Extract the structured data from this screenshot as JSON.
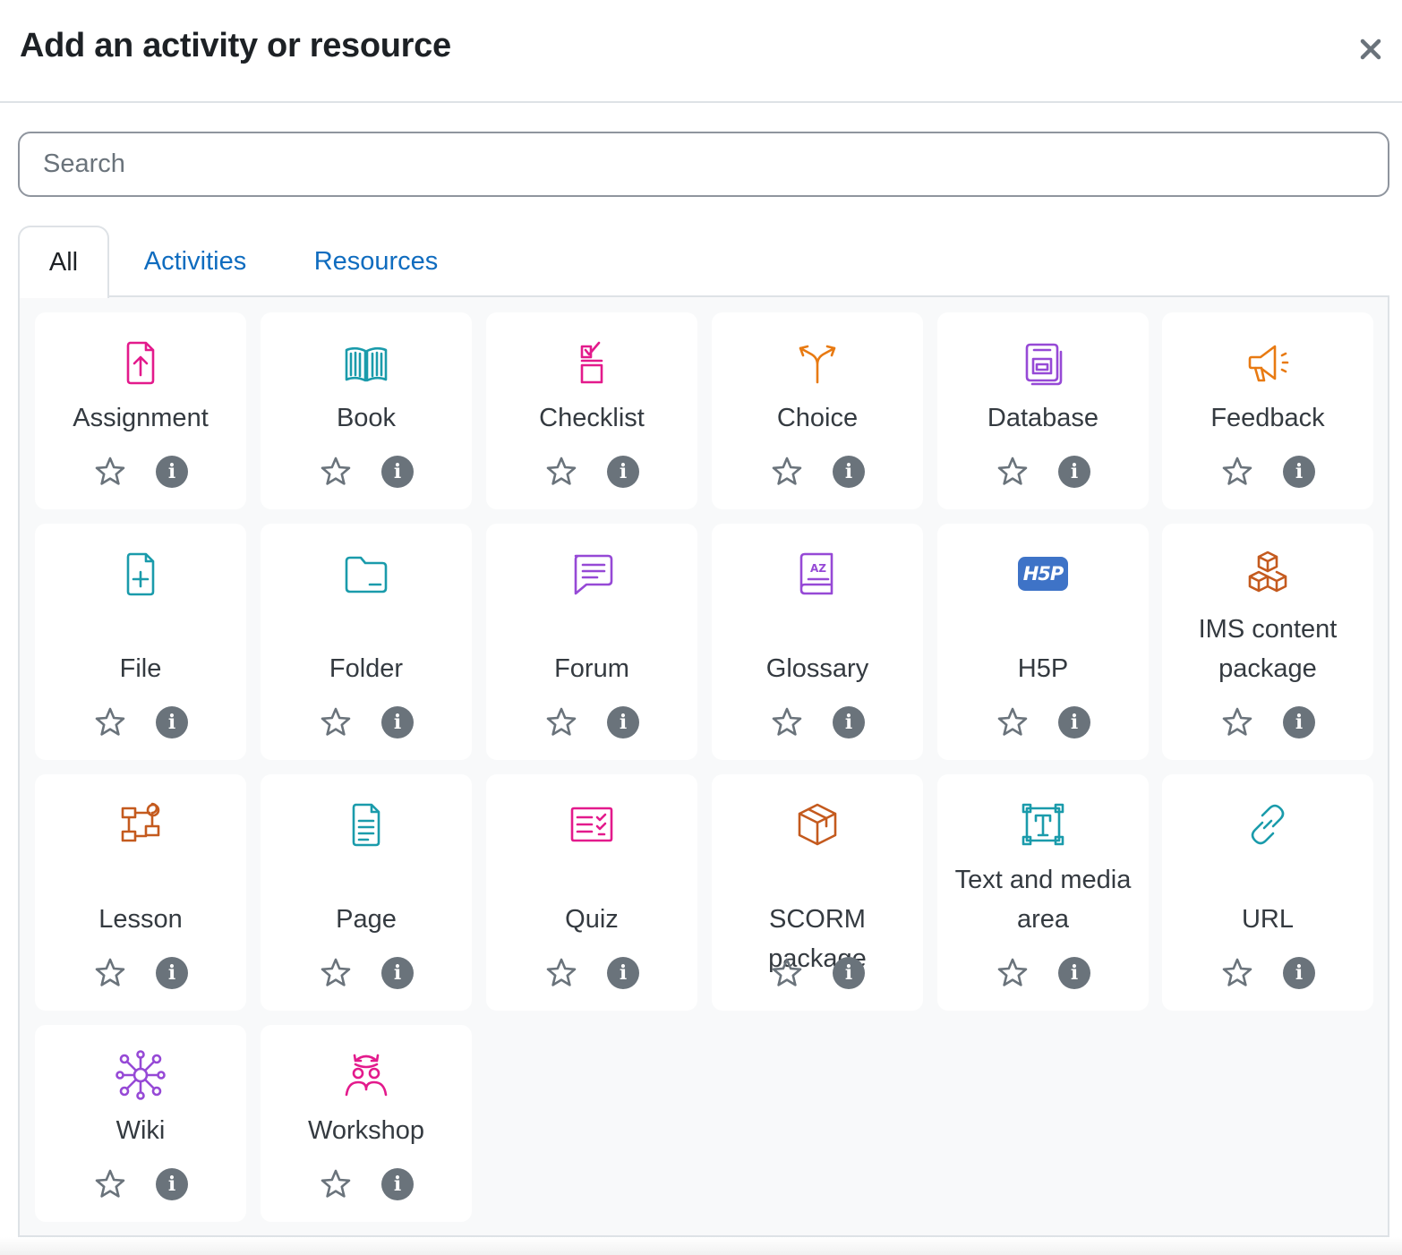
{
  "modal": {
    "title": "Add an activity or resource",
    "close_icon": "close-icon"
  },
  "search": {
    "placeholder": "Search",
    "value": ""
  },
  "tabs": [
    {
      "label": "All",
      "active": true
    },
    {
      "label": "Activities",
      "active": false
    },
    {
      "label": "Resources",
      "active": false
    }
  ],
  "items": [
    {
      "label": "Assignment",
      "icon": "assignment-icon",
      "color": "#e31a8c"
    },
    {
      "label": "Book",
      "icon": "book-icon",
      "color": "#1a9bab"
    },
    {
      "label": "Checklist",
      "icon": "checklist-icon",
      "color": "#e31a8c"
    },
    {
      "label": "Choice",
      "icon": "choice-icon",
      "color": "#e87a12"
    },
    {
      "label": "Database",
      "icon": "database-icon",
      "color": "#9649d6"
    },
    {
      "label": "Feedback",
      "icon": "feedback-icon",
      "color": "#e87a12"
    },
    {
      "label": "File",
      "icon": "file-icon",
      "color": "#1a9bab"
    },
    {
      "label": "Folder",
      "icon": "folder-icon",
      "color": "#1a9bab"
    },
    {
      "label": "Forum",
      "icon": "forum-icon",
      "color": "#9649d6"
    },
    {
      "label": "Glossary",
      "icon": "glossary-icon",
      "color": "#9649d6"
    },
    {
      "label": "H5P",
      "icon": "h5p-icon",
      "color": "#3e73c7"
    },
    {
      "label": "IMS content package",
      "icon": "ims-package-icon",
      "color": "#c45a1e"
    },
    {
      "label": "Lesson",
      "icon": "lesson-icon",
      "color": "#c45a1e"
    },
    {
      "label": "Page",
      "icon": "page-icon",
      "color": "#1a9bab"
    },
    {
      "label": "Quiz",
      "icon": "quiz-icon",
      "color": "#e31a8c"
    },
    {
      "label": "SCORM package",
      "icon": "scorm-package-icon",
      "color": "#c45a1e"
    },
    {
      "label": "Text and media area",
      "icon": "text-media-icon",
      "color": "#1a9bab"
    },
    {
      "label": "URL",
      "icon": "url-icon",
      "color": "#1a9bab"
    },
    {
      "label": "Wiki",
      "icon": "wiki-icon",
      "color": "#9649d6"
    },
    {
      "label": "Workshop",
      "icon": "workshop-icon",
      "color": "#e31a8c"
    }
  ],
  "item_actions": {
    "star_icon": "star-icon",
    "info_icon": "info-icon",
    "info_glyph": "i"
  },
  "h5p_badge": "H5P"
}
